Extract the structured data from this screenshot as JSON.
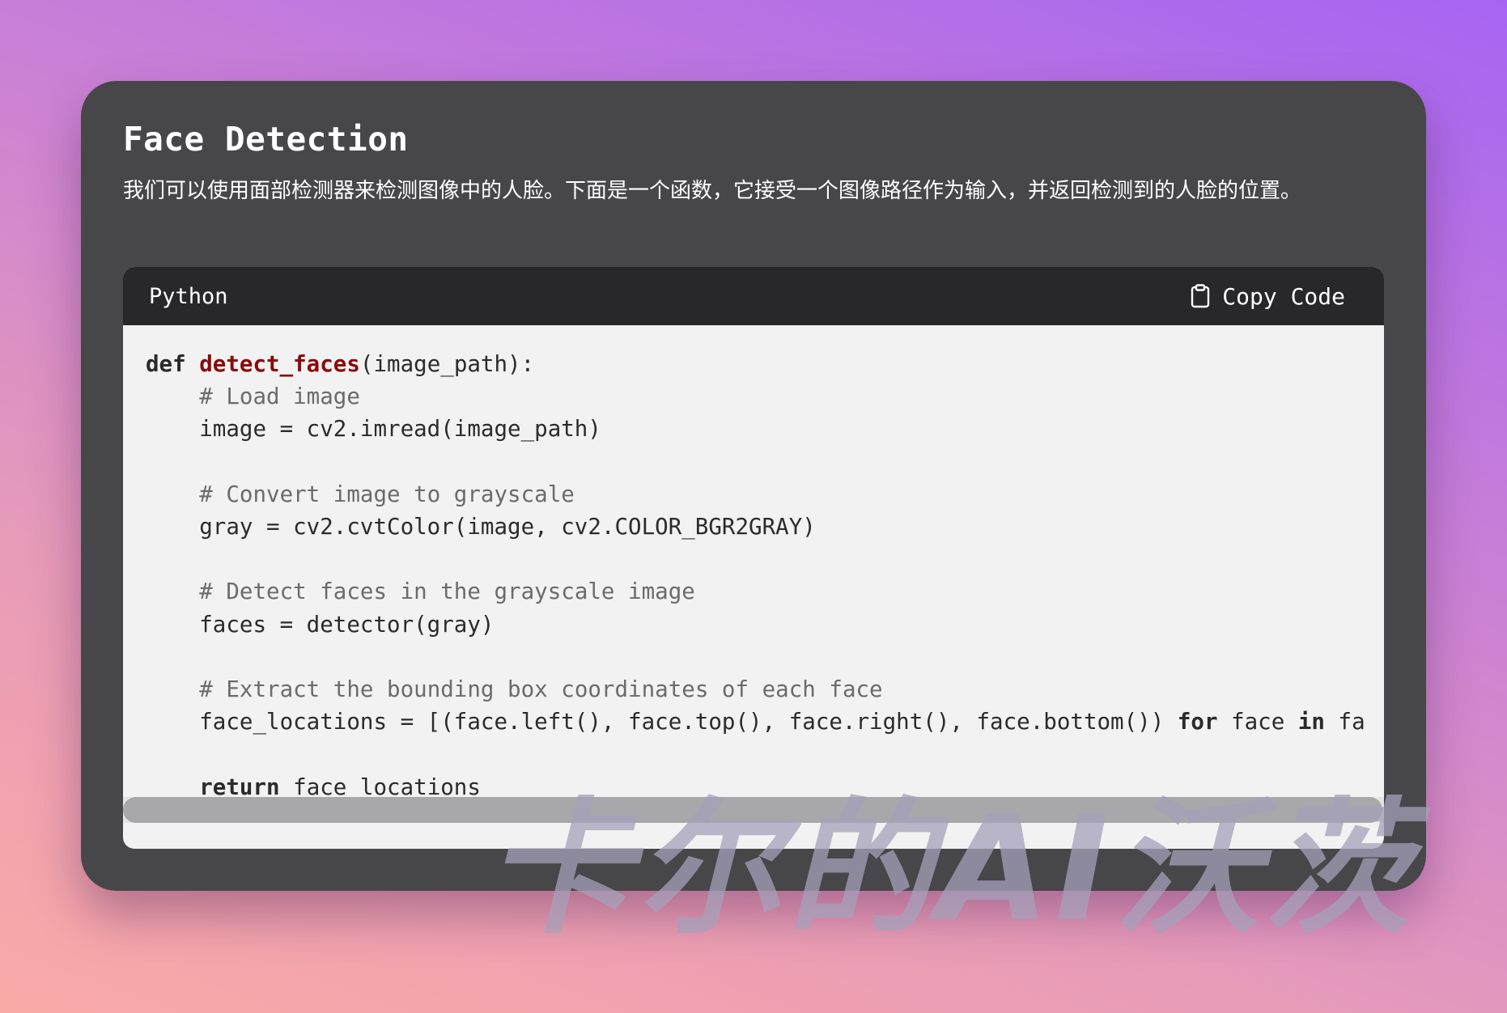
{
  "card": {
    "title": "Face Detection",
    "description": "我们可以使用面部检测器来检测图像中的人脸。下面是一个函数，它接受一个图像路径作为输入，并返回检测到的人脸的位置。"
  },
  "code_block": {
    "language": "Python",
    "copy_label": "Copy Code",
    "copy_icon": "clipboard-icon",
    "lines": [
      [
        {
          "t": "kw",
          "v": "def"
        },
        {
          "t": "plain",
          "v": " "
        },
        {
          "t": "fn",
          "v": "detect_faces"
        },
        {
          "t": "plain",
          "v": "(image_path):"
        }
      ],
      [
        {
          "t": "plain",
          "v": "    "
        },
        {
          "t": "cm",
          "v": "# Load image"
        }
      ],
      [
        {
          "t": "plain",
          "v": "    image = cv2.imread(image_path)"
        }
      ],
      [
        {
          "t": "plain",
          "v": ""
        }
      ],
      [
        {
          "t": "plain",
          "v": "    "
        },
        {
          "t": "cm",
          "v": "# Convert image to grayscale"
        }
      ],
      [
        {
          "t": "plain",
          "v": "    gray = cv2.cvtColor(image, cv2.COLOR_BGR2GRAY)"
        }
      ],
      [
        {
          "t": "plain",
          "v": ""
        }
      ],
      [
        {
          "t": "plain",
          "v": "    "
        },
        {
          "t": "cm",
          "v": "# Detect faces in the grayscale image"
        }
      ],
      [
        {
          "t": "plain",
          "v": "    faces = detector(gray)"
        }
      ],
      [
        {
          "t": "plain",
          "v": ""
        }
      ],
      [
        {
          "t": "plain",
          "v": "    "
        },
        {
          "t": "cm",
          "v": "# Extract the bounding box coordinates of each face"
        }
      ],
      [
        {
          "t": "plain",
          "v": "    face_locations = [(face.left(), face.top(), face.right(), face.bottom()) "
        },
        {
          "t": "kw",
          "v": "for"
        },
        {
          "t": "plain",
          "v": " face "
        },
        {
          "t": "kw",
          "v": "in"
        },
        {
          "t": "plain",
          "v": " fa"
        }
      ],
      [
        {
          "t": "plain",
          "v": ""
        }
      ],
      [
        {
          "t": "plain",
          "v": "    "
        },
        {
          "t": "kw",
          "v": "return"
        },
        {
          "t": "plain",
          "v": " face_locations"
        }
      ]
    ]
  },
  "watermark": "卡尔的AI沃茨",
  "colors": {
    "card_bg": "#474749",
    "code_header_bg": "#28282a",
    "code_bg": "#f2f2f2",
    "function_name": "#8b0a0a",
    "comment": "#6b6b6b"
  }
}
